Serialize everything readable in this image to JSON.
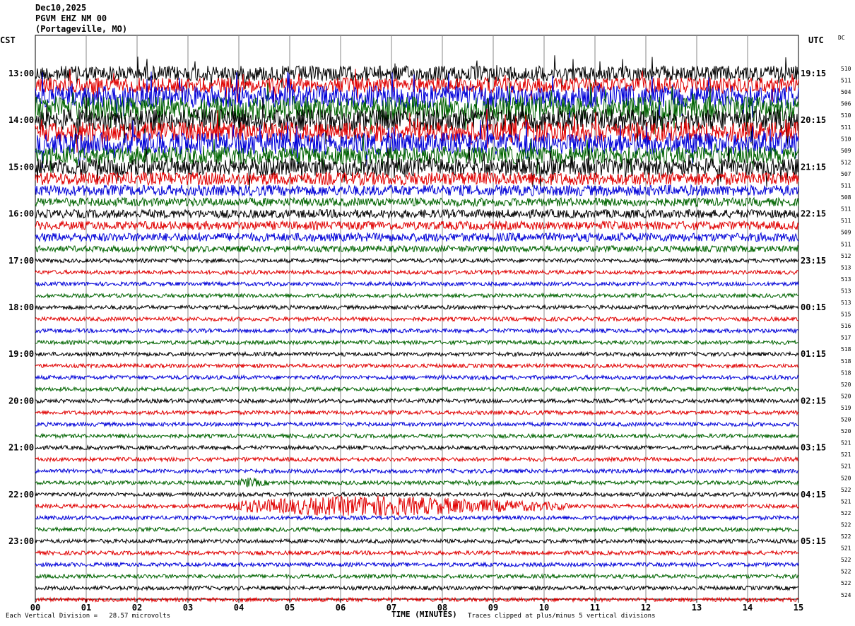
{
  "header": {
    "date": "Dec10,2025",
    "station": "PGVM EHZ NM 00",
    "location": "(Portageville, MO)"
  },
  "left_tz": "CST",
  "right_tz": "UTC",
  "dc_header": "DC",
  "footer": {
    "scale_note": "Each Vertical Division =   28.57 microvolts",
    "x_title": "TIME (MINUTES)",
    "clip_note": "Traces clipped at plus/minus 5 vertical divisions"
  },
  "colors": {
    "trace_cycle": [
      "#000000",
      "#e00000",
      "#0000d8",
      "#006400"
    ],
    "grid": "#888888"
  },
  "chart_data": {
    "type": "line",
    "title": "Dec10,2025 PGVM EHZ NM 00 (Portageville, MO)",
    "xlabel": "TIME (MINUTES)",
    "xlim": [
      0,
      15
    ],
    "x_ticks": [
      "00",
      "01",
      "02",
      "03",
      "04",
      "05",
      "06",
      "07",
      "08",
      "09",
      "10",
      "11",
      "12",
      "13",
      "14",
      "15"
    ],
    "left_hour_labels": [
      "13:00",
      "14:00",
      "15:00",
      "16:00",
      "17:00",
      "18:00",
      "19:00",
      "20:00",
      "21:00",
      "22:00",
      "23:00"
    ],
    "right_hour_labels": [
      "19:15",
      "20:15",
      "21:15",
      "22:15",
      "23:15",
      "00:15",
      "01:15",
      "02:15",
      "03:15",
      "04:15",
      "05:15"
    ],
    "dc_values": [
      510,
      511,
      504,
      506,
      510,
      511,
      510,
      509,
      512,
      507,
      511,
      508,
      511,
      511,
      509,
      511,
      512,
      513,
      513,
      513,
      513,
      515,
      516,
      517,
      518,
      518,
      518,
      520,
      520,
      519,
      520,
      520,
      521,
      521,
      521,
      520,
      522,
      521,
      522,
      522,
      522,
      521,
      522,
      522,
      522,
      524
    ],
    "trace_activity": [
      6,
      6,
      9,
      10,
      9,
      8,
      9,
      7,
      7,
      5,
      4,
      3,
      3,
      3,
      3,
      2,
      1,
      1,
      1,
      1,
      1,
      1,
      1,
      1,
      1,
      1,
      1,
      1,
      1,
      1,
      1,
      1,
      1,
      1,
      1,
      1,
      1,
      1,
      1,
      1,
      1,
      1,
      1,
      1,
      1,
      1
    ],
    "events": [
      {
        "trace": 37,
        "start_min": 3.8,
        "end_min": 10.5,
        "peak_min": 6.6,
        "amplitude": 4
      },
      {
        "trace": 35,
        "start_min": 4.0,
        "end_min": 4.6,
        "peak_min": 4.2,
        "amplitude": 1.5
      },
      {
        "trace": 35,
        "start_min": 8.5,
        "end_min": 8.8,
        "peak_min": 8.6,
        "amplitude": 1.2
      }
    ],
    "grid": true
  }
}
